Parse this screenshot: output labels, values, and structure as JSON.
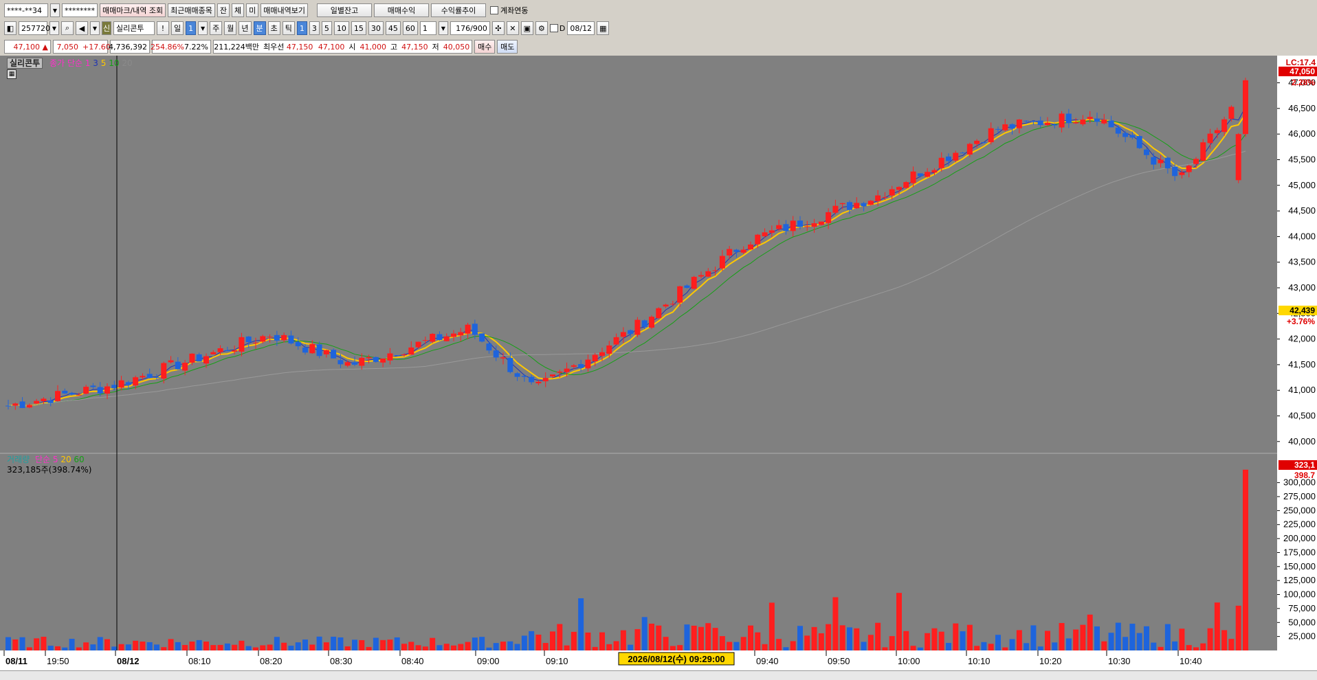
{
  "toolbar1": {
    "account": "****-**34",
    "password": "********",
    "btn_trade_mark": "매매마크/내역 조회",
    "btn_recent_items": "최근매매종목",
    "btn_jan": "잔",
    "btn_che": "체",
    "btn_mi": "미",
    "btn_trade_history": "매매내역보기",
    "btn_daily_balance": "일별잔고",
    "btn_trade_profit": "매매수익",
    "btn_profit_trend": "수익률추이",
    "account_link_label": "계좌연동"
  },
  "toolbar2": {
    "stock_code": "257720",
    "credit_badge": "신",
    "stock_name": "실리콘투",
    "warn": "!",
    "period_day": "일",
    "period_value": "1",
    "period_week": "주",
    "period_month": "월",
    "period_year": "년",
    "period_min": "분",
    "period_sec": "초",
    "period_tick": "틱",
    "intervals": [
      "1",
      "3",
      "5",
      "10",
      "15",
      "30",
      "45",
      "60"
    ],
    "interval_value": "1",
    "count_display": "176/900",
    "d_label": "D",
    "date_value": "08/12"
  },
  "quote": {
    "price": "47,100 ▲",
    "change": "7,050",
    "change_pct": "+17.60%",
    "volume": "4,736,392",
    "volume_ratio": "254.86%",
    "turnover": "7.22%",
    "amount": "211,224백만",
    "best_label": "최우선",
    "best_ask": "47,150",
    "best_bid": "47,100",
    "open_label": "시",
    "open": "41,000",
    "high_label": "고",
    "high": "47,150",
    "low_label": "저",
    "low": "40,050",
    "buy_label": "매수",
    "sell_label": "매도"
  },
  "price_panel": {
    "title": "실리콘투",
    "legend_main": "종가 단순 1",
    "ma_labels": [
      "3",
      "5",
      "10",
      "20"
    ],
    "y_ticks": [
      "47,000",
      "46,500",
      "46,000",
      "45,500",
      "45,000",
      "44,500",
      "44,000",
      "43,500",
      "43,000",
      "42,500",
      "42,000",
      "41,500",
      "41,000",
      "40,500",
      "40,000"
    ],
    "lc_label": "LC:17.4",
    "current_price_tag": "47,050",
    "current_pct_tag": "2.28%",
    "cursor_price_tag": "42,439",
    "cursor_pct_tag": "+3.76%"
  },
  "volume_panel": {
    "legend_main": "거래량",
    "legend_ma": [
      "단순 5",
      "20",
      "60"
    ],
    "info": "323,185주(398.74%)",
    "y_ticks": [
      "300,000",
      "275,000",
      "250,000",
      "225,000",
      "200,000",
      "175,000",
      "150,000",
      "125,000",
      "100,000",
      "75,000",
      "50,000",
      "25,000"
    ],
    "current_tag": "323,1",
    "current_pct_tag": "398.7"
  },
  "x_axis": {
    "labels": [
      "08/11",
      "19:50",
      "08/12",
      "08:10",
      "08:20",
      "08:30",
      "08:40",
      "09:00",
      "09:10",
      "09:40",
      "09:50",
      "10:00",
      "10:10",
      "10:20",
      "10:30",
      "10:40"
    ],
    "cursor_label": "2026/08/12(수) 09:29:00"
  },
  "colors": {
    "up": "#ff1e1e",
    "down": "#1e64dc",
    "background": "#808080",
    "ma3": "#1e32b4",
    "ma5": "#ffc800",
    "ma10": "#14a014"
  },
  "chart_data": {
    "type": "candlestick",
    "key_points": [
      {
        "time": "08/11 close",
        "price": 40700
      },
      {
        "time": "08/12 08:00",
        "price": 41100
      },
      {
        "time": "08:20",
        "price": 42100
      },
      {
        "time": "08:30",
        "price": 41500
      },
      {
        "time": "08:50",
        "price": 42200
      },
      {
        "time": "09:00",
        "price": 41000
      },
      {
        "time": "09:10",
        "price": 42200
      },
      {
        "time": "09:25",
        "price": 43900
      },
      {
        "time": "09:40",
        "price": 44800
      },
      {
        "time": "09:50",
        "price": 46100
      },
      {
        "time": "10:10",
        "price": 46400
      },
      {
        "time": "10:30",
        "price": 45100
      },
      {
        "time": "10:48",
        "price": 47050
      }
    ],
    "ylim": [
      39850,
      47450
    ]
  }
}
